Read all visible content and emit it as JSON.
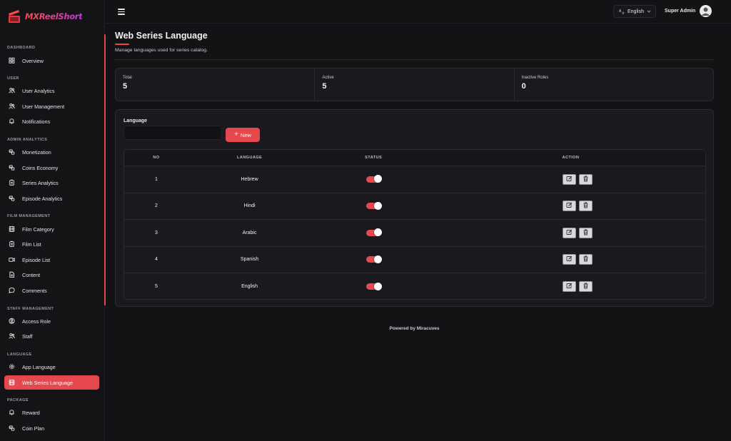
{
  "app": {
    "name": "MXReelShort"
  },
  "header": {
    "language": "English",
    "user_name": "Super Admin"
  },
  "sidebar": {
    "sections": [
      {
        "title": "DASHBOARD",
        "items": [
          {
            "label": "Overview",
            "icon": "grid-icon"
          }
        ]
      },
      {
        "title": "USER",
        "items": [
          {
            "label": "User Analytics",
            "icon": "users-icon"
          },
          {
            "label": "User Management",
            "icon": "users-icon"
          },
          {
            "label": "Notifications",
            "icon": "bell-icon"
          }
        ]
      },
      {
        "title": "ADMIN ANALYTICS",
        "items": [
          {
            "label": "Monetization",
            "icon": "coins-icon"
          },
          {
            "label": "Coins Economy",
            "icon": "coins-icon"
          },
          {
            "label": "Series Analytics",
            "icon": "clipboard-icon"
          },
          {
            "label": "Episode Analytics",
            "icon": "coins-icon"
          }
        ]
      },
      {
        "title": "FILM MANAGEMENT",
        "items": [
          {
            "label": "Film Category",
            "icon": "film-icon"
          },
          {
            "label": "Film List",
            "icon": "clipboard-icon"
          },
          {
            "label": "Episode List",
            "icon": "video-icon"
          },
          {
            "label": "Content",
            "icon": "document-icon"
          },
          {
            "label": "Comments",
            "icon": "comment-icon"
          }
        ]
      },
      {
        "title": "STAFF MANAGEMENT",
        "items": [
          {
            "label": "Access Role",
            "icon": "user-circle-icon"
          },
          {
            "label": "Staff",
            "icon": "users-icon"
          }
        ]
      },
      {
        "title": "LANGUAGE",
        "items": [
          {
            "label": "App Language",
            "icon": "gear-icon"
          },
          {
            "label": "Web Series Language",
            "icon": "film-icon",
            "active": true
          }
        ]
      },
      {
        "title": "PACKAGE",
        "items": [
          {
            "label": "Reward",
            "icon": "bell-icon"
          },
          {
            "label": "Coin Plan",
            "icon": "coins-icon"
          }
        ]
      }
    ]
  },
  "page": {
    "title": "Web Series Language",
    "subtitle": "Manage languages used for series catalog."
  },
  "stats": [
    {
      "label": "Total",
      "value": "5"
    },
    {
      "label": "Active",
      "value": "5"
    },
    {
      "label": "Inactive Roles",
      "value": "0"
    }
  ],
  "filter": {
    "label": "Language",
    "value": "",
    "new_button": "New"
  },
  "table": {
    "headers": [
      "NO",
      "LANGUAGE",
      "STATUS",
      "ACTION"
    ],
    "rows": [
      {
        "no": "1",
        "language": "Hebrew",
        "status": true
      },
      {
        "no": "2",
        "language": "Hindi",
        "status": true
      },
      {
        "no": "3",
        "language": "Arabic",
        "status": true
      },
      {
        "no": "4",
        "language": "Spanish",
        "status": true
      },
      {
        "no": "5",
        "language": "English",
        "status": true
      }
    ]
  },
  "footer": {
    "text": "Powered by Miracuves"
  },
  "colors": {
    "accent": "#e5484d",
    "background": "#131316",
    "card": "#1a1a1e"
  }
}
